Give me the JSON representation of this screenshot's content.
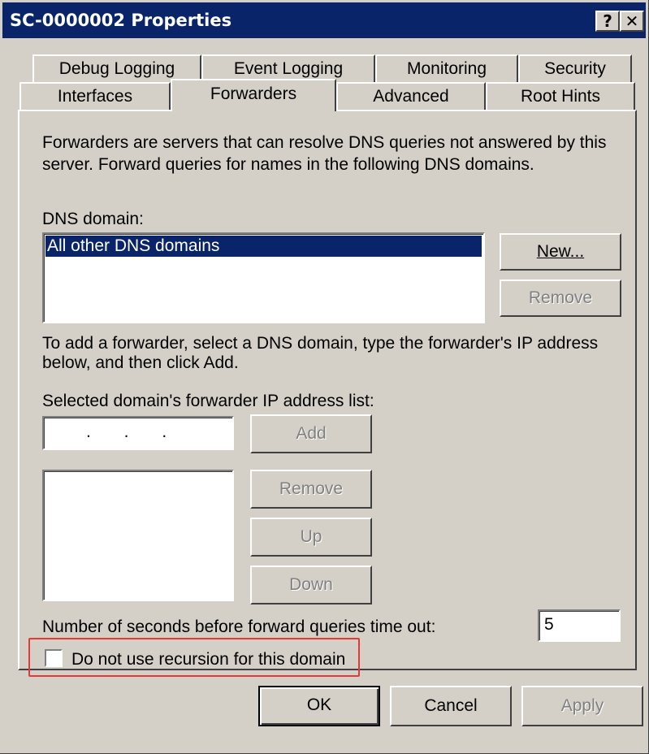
{
  "window": {
    "title": "SC-0000002 Properties",
    "help_glyph": "?",
    "close_glyph": "✕"
  },
  "tabs_row1": [
    "Debug Logging",
    "Event Logging",
    "Monitoring",
    "Security"
  ],
  "tabs_row2": [
    "Interfaces",
    "Forwarders",
    "Advanced",
    "Root Hints"
  ],
  "active_tab": "Forwarders",
  "description": [
    "Forwarders are servers that can resolve DNS queries not answered by this",
    "server. Forward queries for names in the following DNS domains."
  ],
  "dns_domain": {
    "label": "DNS domain:",
    "items": [
      "All other DNS domains"
    ],
    "selected": "All other DNS domains",
    "new_button": "New...",
    "remove_button": "Remove"
  },
  "instructions": [
    "To add a forwarder, select a DNS domain, type the forwarder's IP address",
    "below, and then click Add."
  ],
  "forwarder_ip": {
    "label": "Selected domain's forwarder IP address list:",
    "ip_input_value": ".       .       .",
    "add_button": "Add",
    "remove_button": "Remove",
    "up_button": "Up",
    "down_button": "Down"
  },
  "timeout": {
    "label": "Number of seconds before forward queries time out:",
    "value": "5"
  },
  "recursion_checkbox": {
    "label": "Do not use recursion for this domain",
    "checked": false
  },
  "footer": {
    "ok": "OK",
    "cancel": "Cancel",
    "apply": "Apply"
  },
  "colors": {
    "titlebar": "#0a246a",
    "dialog_face": "#d4d0c8",
    "selection": "#0a246a",
    "highlight_box": "#e53935",
    "disabled_text": "#808080"
  }
}
